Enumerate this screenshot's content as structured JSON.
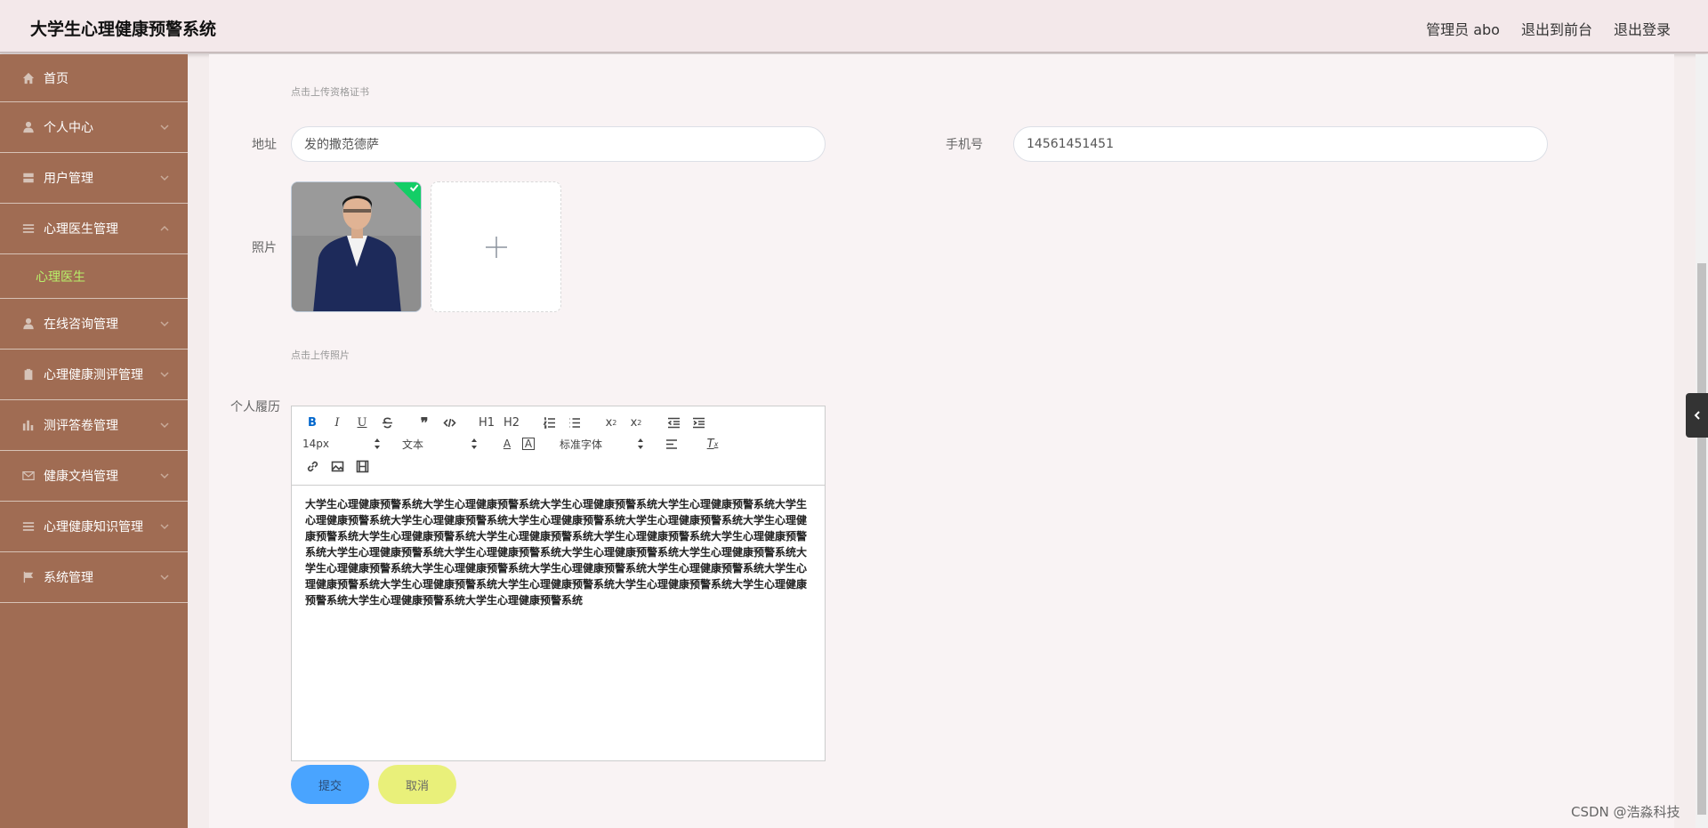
{
  "header": {
    "title": "大学生心理健康预警系统",
    "user": "管理员 abo",
    "to_front": "退出到前台",
    "logout": "退出登录"
  },
  "sidebar": {
    "items": [
      {
        "label": "首页",
        "icon": "home-icon"
      },
      {
        "label": "个人中心",
        "icon": "user-icon"
      },
      {
        "label": "用户管理",
        "icon": "server-icon"
      },
      {
        "label": "心理医生管理",
        "icon": "menu-icon"
      },
      {
        "label": "在线咨询管理",
        "icon": "user-icon"
      },
      {
        "label": "心理健康测评管理",
        "icon": "clipboard-icon"
      },
      {
        "label": "测评答卷管理",
        "icon": "bar-chart-icon"
      },
      {
        "label": "健康文档管理",
        "icon": "mail-icon"
      },
      {
        "label": "心理健康知识管理",
        "icon": "menu-icon"
      },
      {
        "label": "系统管理",
        "icon": "flag-icon"
      }
    ],
    "submenu": {
      "label": "心理医生"
    }
  },
  "form": {
    "certificate_hint": "点击上传资格证书",
    "address_label": "地址",
    "address_value": "发的撒范德萨",
    "phone_label": "手机号",
    "phone_value": "14561451451",
    "photo_label": "照片",
    "photo_hint": "点击上传照片",
    "resume_label": "个人履历"
  },
  "editor": {
    "font_size": "14px",
    "header_select": "文本",
    "font_family": "标准字体",
    "h1": "H1",
    "h2": "H2",
    "content": "大学生心理健康预警系统大学生心理健康预警系统大学生心理健康预警系统大学生心理健康预警系统大学生心理健康预警系统大学生心理健康预警系统大学生心理健康预警系统大学生心理健康预警系统大学生心理健康预警系统大学生心理健康预警系统大学生心理健康预警系统大学生心理健康预警系统大学生心理健康预警系统大学生心理健康预警系统大学生心理健康预警系统大学生心理健康预警系统大学生心理健康预警系统大学生心理健康预警系统大学生心理健康预警系统大学生心理健康预警系统大学生心理健康预警系统大学生心理健康预警系统大学生心理健康预警系统大学生心理健康预警系统大学生心理健康预警系统大学生心理健康预警系统大学生心理健康预警系统大学生心理健康预警系统"
  },
  "buttons": {
    "submit": "提交",
    "cancel": "取消"
  },
  "watermark": "CSDN @浩淼科技",
  "colors": {
    "sidebar_bg": "#a06c53",
    "submenu_active": "#b8f06a",
    "submit_btn": "#49a4ff",
    "cancel_btn": "#e9f07a",
    "success_badge": "#13ce66"
  }
}
